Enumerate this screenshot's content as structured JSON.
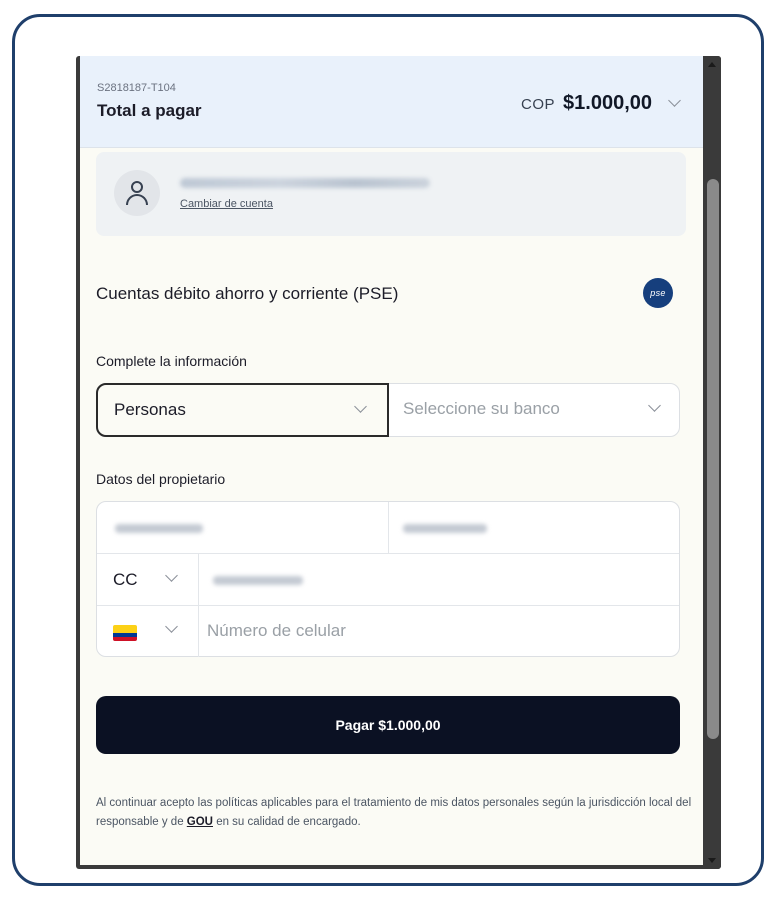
{
  "header": {
    "order_id": "S2818187-T104",
    "total_label": "Total a pagar",
    "currency": "COP",
    "amount": "$1.000,00"
  },
  "account": {
    "change_label": "Cambiar de cuenta"
  },
  "payment_method": {
    "title": "Cuentas débito ahorro y corriente (PSE)",
    "logo_text": "pse"
  },
  "form": {
    "info_label": "Complete la información",
    "person_type": "Personas",
    "bank_placeholder": "Seleccione su banco",
    "owner_label": "Datos del propietario",
    "doc_type": "CC",
    "phone_placeholder": "Número de celular"
  },
  "pay_button": {
    "label": "Pagar $1.000,00"
  },
  "disclaimer": {
    "text_before": "Al continuar acepto las políticas aplicables para el tratamiento de mis datos personales según la jurisdicción local del responsable y de ",
    "link": "GOU",
    "text_after": " en su calidad de encargado."
  },
  "colors": {
    "frame_border": "#1f3f6b",
    "header_bg": "#e9f1fb",
    "pay_button_bg": "#0b1123",
    "pse_logo_bg": "#163f7d"
  }
}
